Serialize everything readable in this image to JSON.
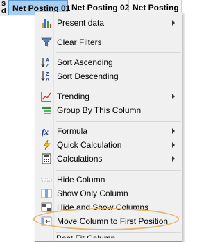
{
  "header": {
    "left_cell_glyph_top": "s",
    "left_cell_glyph_bottom": "d",
    "columns": [
      "Net Posting 01",
      "Net Posting 02",
      "Net Posting"
    ]
  },
  "menu": {
    "items": [
      {
        "label": "Present data",
        "icon": "bar-chart-icon",
        "submenu": true
      },
      {
        "label": "Clear Filters",
        "icon": "funnel-icon",
        "submenu": false
      },
      {
        "label": "Sort Ascending",
        "icon": "sort-az-icon",
        "submenu": false
      },
      {
        "label": "Sort Descending",
        "icon": "sort-za-icon",
        "submenu": false
      },
      {
        "label": "Trending",
        "icon": "trend-chart-icon",
        "submenu": true
      },
      {
        "label": "Group By This Column",
        "icon": "group-icon",
        "submenu": false
      },
      {
        "label": "Formula",
        "icon": "fx-icon",
        "submenu": true
      },
      {
        "label": "Quick Calculation",
        "icon": "lightning-icon",
        "submenu": true
      },
      {
        "label": "Calculations",
        "icon": "calculator-icon",
        "submenu": true
      },
      {
        "label": "Hide Column",
        "icon": "hide-column-icon",
        "submenu": false
      },
      {
        "label": "Show Only Column",
        "icon": "show-only-column-icon",
        "submenu": false
      },
      {
        "label": "Hide and Show Columns",
        "icon": "hide-show-columns-icon",
        "submenu": false
      },
      {
        "label": "Move Column to First Position",
        "icon": "move-first-icon",
        "submenu": false
      }
    ],
    "truncated_next_label": "Best Fit Column"
  },
  "colors": {
    "selected_header": "#a9cff0",
    "highlight_ellipse": "#e4b56c",
    "menu_background": "#f0f0f0"
  }
}
